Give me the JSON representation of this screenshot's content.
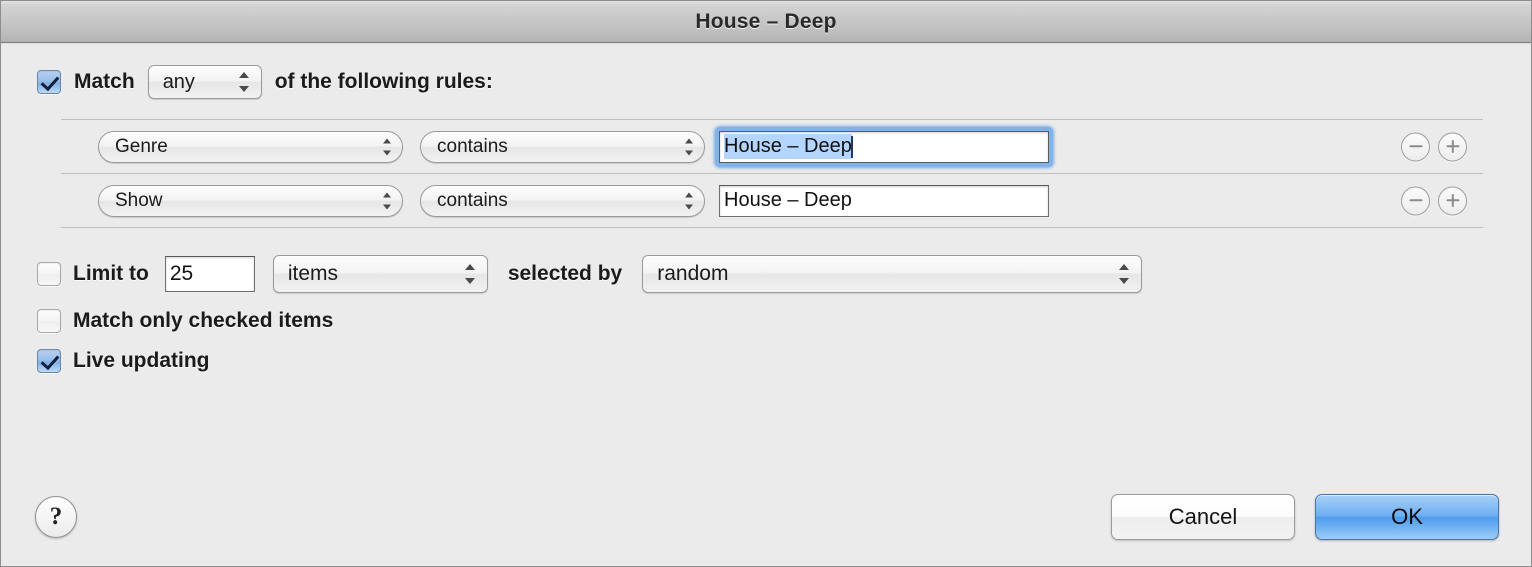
{
  "window": {
    "title": "House – Deep"
  },
  "match_row": {
    "checkbox_checked": true,
    "prefix_label": "Match",
    "operator_value": "any",
    "suffix_label": "of the following rules:"
  },
  "rules": [
    {
      "field": "Genre",
      "operator": "contains",
      "value": "House – Deep",
      "focused": true,
      "selected": true,
      "remove_label": "−",
      "add_label": "+"
    },
    {
      "field": "Show",
      "operator": "contains",
      "value": "House – Deep",
      "focused": false,
      "selected": false,
      "remove_label": "−",
      "add_label": "+"
    }
  ],
  "options": {
    "limit": {
      "checked": false,
      "label": "Limit to",
      "amount": "25",
      "unit": "items",
      "selected_by_label": "selected by",
      "order": "random"
    },
    "match_only_checked": {
      "checked": false,
      "label": "Match only checked items"
    },
    "live_updating": {
      "checked": true,
      "label": "Live updating"
    }
  },
  "footer": {
    "help_label": "?",
    "cancel_label": "Cancel",
    "ok_label": "OK"
  },
  "colors": {
    "window_background": "#ebebeb",
    "focus_ring": "#7eb4ea",
    "selection": "#b4d5fe",
    "default_button": "#6fb0f2",
    "separator": "#c0c0c0"
  }
}
